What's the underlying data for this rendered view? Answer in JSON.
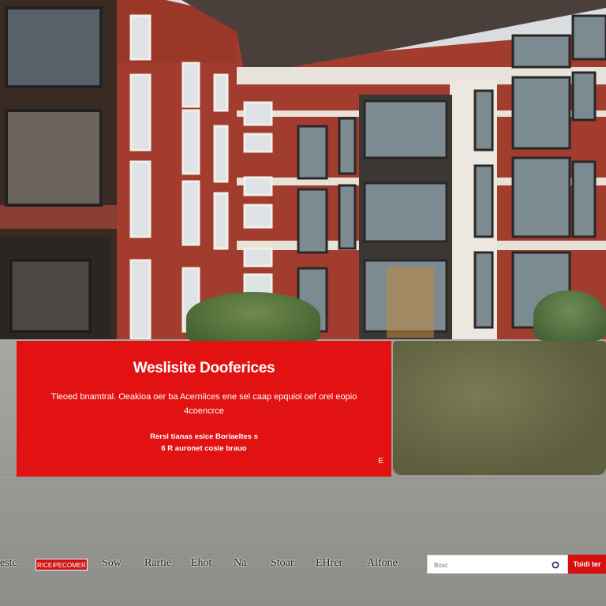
{
  "hero": {
    "title": "Weslisite Dooferices",
    "body": "Tleoed bnamtral. Oeakioa oer ba Acerniices ene sel caap epquiol oef orel eopio 4coencrce",
    "info_line1": "Rersl tianas esice Boriaeltes s",
    "info_line2": "6 R auronet cosie brauo",
    "corner_mark": "E"
  },
  "nav": {
    "items": [
      "estc",
      "Sow",
      "Rartie",
      "Ehot",
      "Na",
      "Stoar",
      "EHrer",
      "Alfone"
    ],
    "badge": "RICEIPECOMER"
  },
  "search": {
    "placeholder": "Bosc",
    "button": "Toidi ter"
  },
  "colors": {
    "hero_red": "#e21212",
    "button_red": "#d70f0f"
  }
}
